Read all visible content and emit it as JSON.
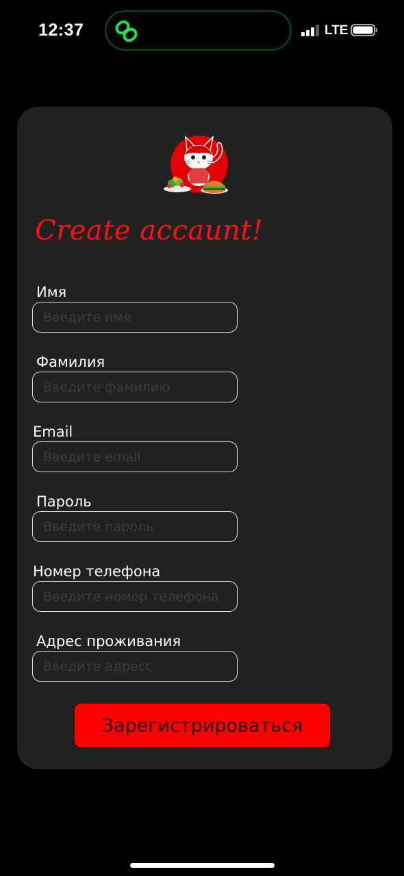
{
  "status_bar": {
    "time": "12:37",
    "network": "LTE",
    "signal_bars_active": 3,
    "signal_bars_total": 4
  },
  "form": {
    "title": "Create accaunt!",
    "fields": [
      {
        "label": "Имя",
        "placeholder": "Введите имя",
        "value": ""
      },
      {
        "label": "Фамилия",
        "placeholder": "Введите фамилию",
        "value": ""
      },
      {
        "label": "Email",
        "placeholder": "Введите email",
        "value": ""
      },
      {
        "label": "Пароль",
        "placeholder": "Введите пароль",
        "value": ""
      },
      {
        "label": "Номер телефона",
        "placeholder": "Введите номер телефона",
        "value": ""
      },
      {
        "label": "Адрес проживания",
        "placeholder": "Введите адресс",
        "value": ""
      }
    ],
    "submit_label": "Зарегистрироваться"
  },
  "icons": {
    "app_logo": "red-cat-with-food-logo",
    "island": "chain-link-icon"
  },
  "colors": {
    "accent": "#ff0000",
    "card_background": "#212121",
    "page_background": "#000000",
    "island_icon": "#22e04a"
  }
}
